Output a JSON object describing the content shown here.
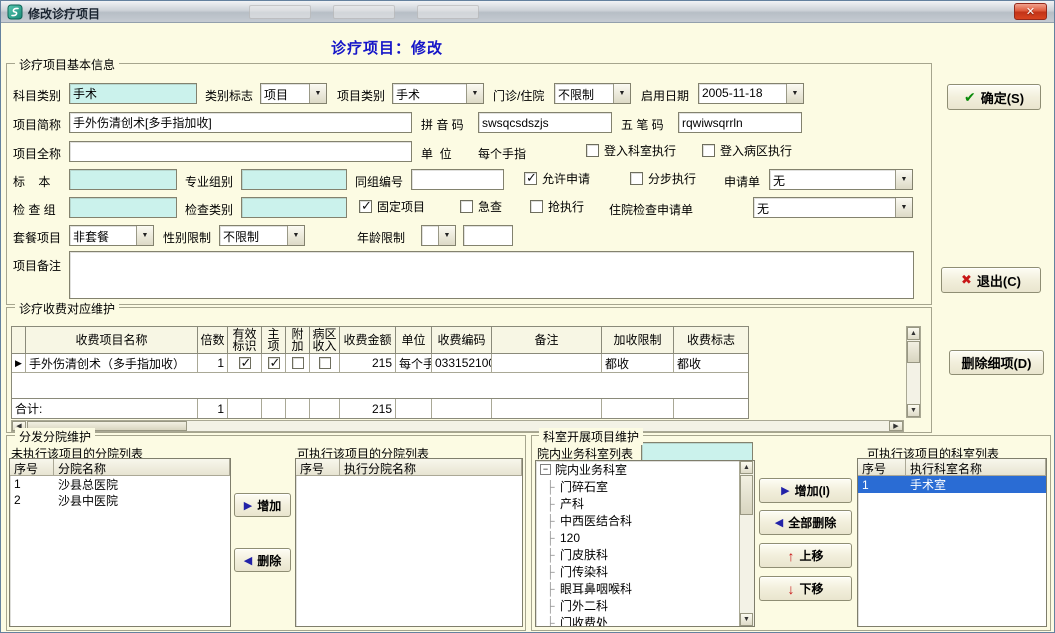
{
  "window": {
    "title": "修改诊疗项目"
  },
  "page": {
    "title": "诊疗项目：修改"
  },
  "icons": {
    "dropdown": "▼",
    "check": "✔",
    "cross": "✖",
    "arrow_right": "▶",
    "arrow_left": "◀",
    "arrow_up": "↑",
    "arrow_down": "↓",
    "row_marker": "▶",
    "scroll_up": "▲",
    "scroll_down": "▼",
    "scroll_left": "◀",
    "scroll_right": "▶",
    "tree_collapse": "−",
    "tree_branch": "├",
    "close": "✕"
  },
  "actions": {
    "ok": "确定(S)",
    "exit": "退出(C)",
    "delete_detail": "删除细项(D)"
  },
  "basic": {
    "legend": "诊疗项目基本信息",
    "row1": {
      "subject_label": "科目类别",
      "subject_value": "手术",
      "type_flag_label": "类别标志",
      "type_flag_value": "项目",
      "item_type_label": "项目类别",
      "item_type_value": "手术",
      "clinic_label": "门诊/住院",
      "clinic_value": "不限制",
      "start_date_label": "启用日期",
      "start_date_value": "2005-11-18"
    },
    "row2": {
      "short_name_label": "项目简称",
      "short_name_value": "手外伤清创术[多手指加收]",
      "pinyin_label": "拼 音 码",
      "pinyin_value": "swsqcsdszjs",
      "wubi_label": "五 笔 码",
      "wubi_value": "rqwiwsqrrln"
    },
    "row3": {
      "full_name_label": "项目全称",
      "full_name_value": "",
      "unit_label": "单  位",
      "unit_value": "每个手指",
      "dept_exec_label": "登入科室执行",
      "dept_exec_checked": false,
      "ward_exec_label": "登入病区执行",
      "ward_exec_checked": false
    },
    "row4": {
      "specimen_label": "标    本",
      "specimen_value": "",
      "prof_group_label": "专业组别",
      "prof_group_value": "",
      "group_no_label": "同组编号",
      "group_no_value": "",
      "allow_apply_label": "允许申请",
      "allow_apply_checked": true,
      "step_exec_label": "分步执行",
      "step_exec_checked": false,
      "apply_form_label": "申请单",
      "apply_form_value": "无"
    },
    "row5": {
      "check_group_label": "检 查 组",
      "check_group_value": "",
      "check_type_label": "检查类别",
      "check_type_value": "",
      "fixed_label": "固定项目",
      "fixed_checked": true,
      "urgent_label": "急查",
      "urgent_checked": false,
      "grab_label": "抢执行",
      "grab_checked": false,
      "inpatient_form_label": "住院检查申请单",
      "inpatient_form_value": "无"
    },
    "row6": {
      "package_label": "套餐项目",
      "package_value": "非套餐",
      "gender_label": "性别限制",
      "gender_value": "不限制",
      "age_label": "年龄限制",
      "age_select_value": "",
      "age_value": ""
    },
    "row7": {
      "remark_label": "项目备注",
      "remark_value": ""
    }
  },
  "fee": {
    "legend": "诊疗收费对应维护",
    "headers": [
      "收费项目名称",
      "倍数",
      "有效\n标识",
      "主\n项",
      "附\n加",
      "病区\n收入",
      "收费金额",
      "单位",
      "收费编码",
      "备注",
      "加收限制",
      "收费标志"
    ],
    "row": {
      "name": "手外伤清创术（多手指加收）",
      "multiple": "1",
      "valid": true,
      "main": true,
      "extra": false,
      "ward_income": false,
      "amount": "215",
      "unit": "每个手",
      "code": "033152100",
      "remark": "",
      "add_limit": "都收",
      "fee_flag": "都收"
    },
    "total": {
      "label": "合计:",
      "multiple": "1",
      "amount": "215"
    }
  },
  "branch": {
    "legend": "分发分院维护",
    "left_title": "未执行该项目的分院列表",
    "left_headers": [
      "序号",
      "分院名称"
    ],
    "left_rows": [
      [
        "1",
        "沙县总医院"
      ],
      [
        "2",
        "沙县中医院"
      ]
    ],
    "add_btn": "增加",
    "remove_btn": "删除",
    "right_title": "可执行该项目的分院列表",
    "right_headers": [
      "序号",
      "执行分院名称"
    ]
  },
  "dept": {
    "legend": "科室开展项目维护",
    "list_title": "院内业务科室列表",
    "search_value": "",
    "tree_root": "院内业务科室",
    "tree_items": [
      "门碎石室",
      "产科",
      "中西医结合科",
      "120",
      "门皮肤科",
      "门传染科",
      "眼耳鼻咽喉科",
      "门外二科",
      "门收费处"
    ],
    "add_btn": "增加(I)",
    "remove_all_btn": "全部删除",
    "up_btn": "上移",
    "down_btn": "下移",
    "right_title": "可执行该项目的科室列表",
    "right_headers": [
      "序号",
      "执行科室名称"
    ],
    "right_rows": [
      [
        "1",
        "手术室"
      ]
    ]
  }
}
